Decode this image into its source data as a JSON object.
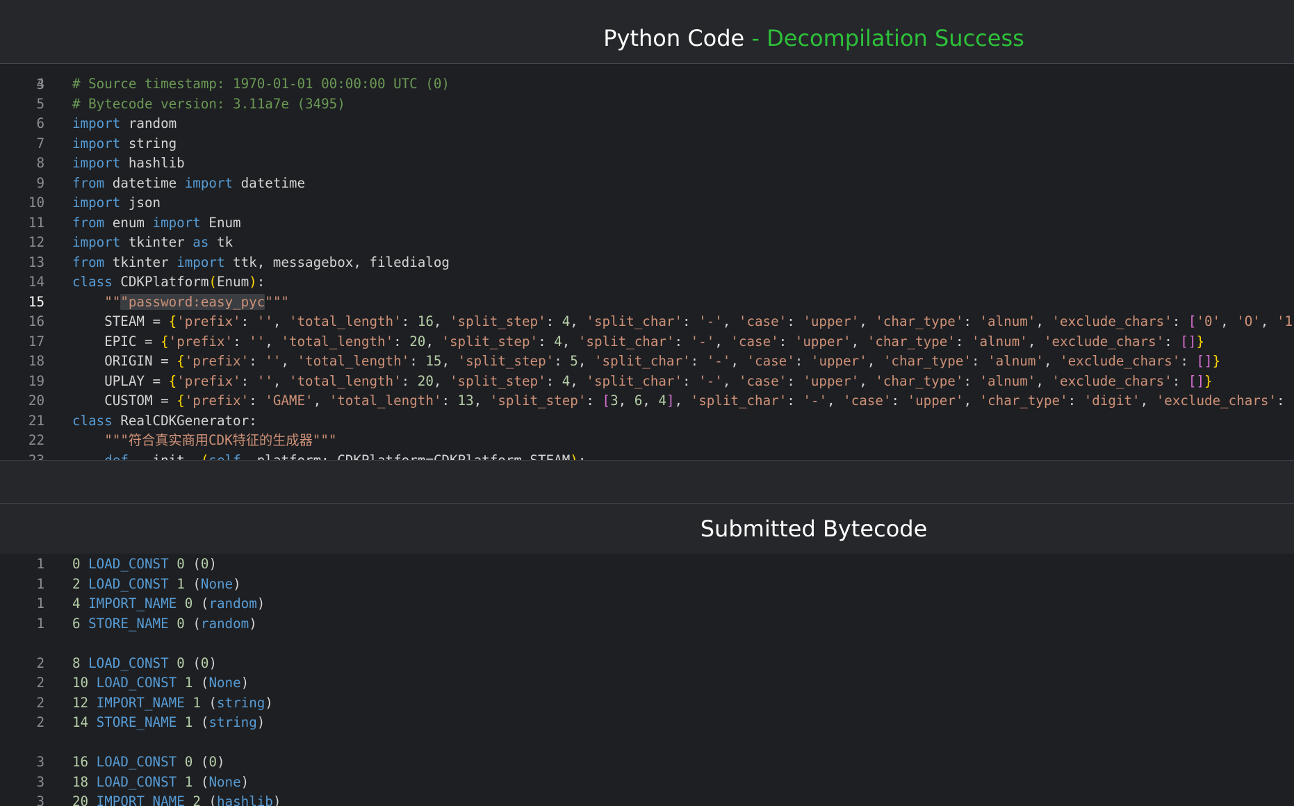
{
  "top_panel": {
    "title_main": "Python Code",
    "title_sep": " - ",
    "title_status": "Decompilation Success"
  },
  "python_code": {
    "partial_top": "# Bytecode version: 3.11a7e (3495)",
    "current_line": "15",
    "lines": [
      {
        "n": "4",
        "text": "# Source timestamp: 1970-01-01 00:00:00 UTC (0)"
      },
      {
        "n": "5",
        "text": ""
      },
      {
        "n": "6",
        "text": "import random"
      },
      {
        "n": "7",
        "text": "import string"
      },
      {
        "n": "8",
        "text": "import hashlib"
      },
      {
        "n": "9",
        "text": "from datetime import datetime"
      },
      {
        "n": "10",
        "text": "import json"
      },
      {
        "n": "11",
        "text": "from enum import Enum"
      },
      {
        "n": "12",
        "text": "import tkinter as tk"
      },
      {
        "n": "13",
        "text": "from tkinter import ttk, messagebox, filedialog"
      },
      {
        "n": "14",
        "text": "class CDKPlatform(Enum):"
      },
      {
        "n": "15",
        "text": "    \"\"\"password:easy_pyc\"\"\""
      },
      {
        "n": "16",
        "text": "    STEAM = {'prefix': '', 'total_length': 16, 'split_step': 4, 'split_char': '-', 'case': 'upper', 'char_type': 'alnum', 'exclude_chars': ['0', 'O', '1"
      },
      {
        "n": "17",
        "text": "    EPIC = {'prefix': '', 'total_length': 20, 'split_step': 4, 'split_char': '-', 'case': 'upper', 'char_type': 'alnum', 'exclude_chars': []}"
      },
      {
        "n": "18",
        "text": "    ORIGIN = {'prefix': '', 'total_length': 15, 'split_step': 5, 'split_char': '-', 'case': 'upper', 'char_type': 'alnum', 'exclude_chars': []}"
      },
      {
        "n": "19",
        "text": "    UPLAY = {'prefix': '', 'total_length': 20, 'split_step': 4, 'split_char': '-', 'case': 'upper', 'char_type': 'alnum', 'exclude_chars': []}"
      },
      {
        "n": "20",
        "text": "    CUSTOM = {'prefix': 'GAME', 'total_length': 13, 'split_step': [3, 6, 4], 'split_char': '-', 'case': 'upper', 'char_type': 'digit', 'exclude_chars':"
      },
      {
        "n": "21",
        "text": "class RealCDKGenerator:"
      },
      {
        "n": "22",
        "text": "    \"\"\"符合真实商用CDK特征的生成器\"\"\""
      },
      {
        "n": "23",
        "text": "    def __init__(self, platform: CDKPlatform=CDKPlatform.STEAM):"
      }
    ]
  },
  "bottom_panel": {
    "title": "Submitted Bytecode"
  },
  "bytecode": {
    "lines": [
      {
        "n": "1",
        "off": "0",
        "op": "LOAD_CONST",
        "arg": "0",
        "val": "0"
      },
      {
        "n": "1",
        "off": "2",
        "op": "LOAD_CONST",
        "arg": "1",
        "val": "None"
      },
      {
        "n": "1",
        "off": "4",
        "op": "IMPORT_NAME",
        "arg": "0",
        "val": "random"
      },
      {
        "n": "1",
        "off": "6",
        "op": "STORE_NAME",
        "arg": "0",
        "val": "random"
      },
      {
        "n": "",
        "off": "",
        "op": "",
        "arg": "",
        "val": ""
      },
      {
        "n": "2",
        "off": "8",
        "op": "LOAD_CONST",
        "arg": "0",
        "val": "0"
      },
      {
        "n": "2",
        "off": "10",
        "op": "LOAD_CONST",
        "arg": "1",
        "val": "None"
      },
      {
        "n": "2",
        "off": "12",
        "op": "IMPORT_NAME",
        "arg": "1",
        "val": "string"
      },
      {
        "n": "2",
        "off": "14",
        "op": "STORE_NAME",
        "arg": "1",
        "val": "string"
      },
      {
        "n": "",
        "off": "",
        "op": "",
        "arg": "",
        "val": ""
      },
      {
        "n": "3",
        "off": "16",
        "op": "LOAD_CONST",
        "arg": "0",
        "val": "0"
      },
      {
        "n": "3",
        "off": "18",
        "op": "LOAD_CONST",
        "arg": "1",
        "val": "None"
      },
      {
        "n": "3",
        "off": "20",
        "op": "IMPORT_NAME",
        "arg": "2",
        "val": "hashlib"
      }
    ]
  },
  "colors": {
    "background": "#1e1f22",
    "header": "#25272b",
    "success": "#2ec13a",
    "keyword": "#569cd6",
    "string": "#ce9178",
    "number": "#b5cea8",
    "comment": "#6a9955"
  }
}
